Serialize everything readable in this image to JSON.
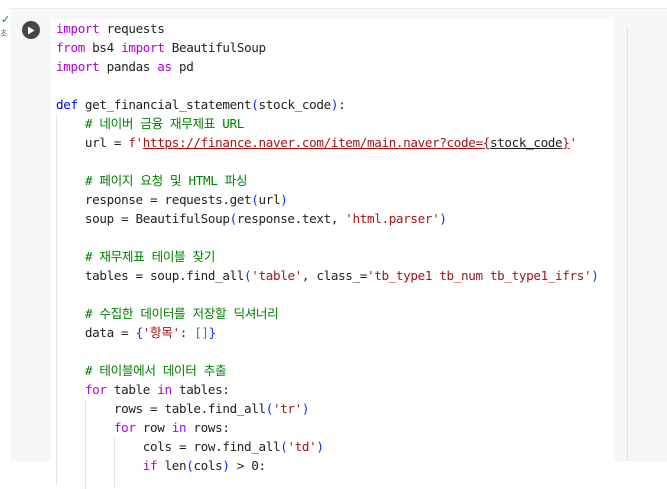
{
  "cell": {
    "status_check": "✓",
    "status_time": "초"
  },
  "code": [
    [
      {
        "t": "import",
        "c": "kw"
      },
      {
        "t": " requests"
      }
    ],
    [
      {
        "t": "from",
        "c": "kw"
      },
      {
        "t": " bs4 "
      },
      {
        "t": "import",
        "c": "kw"
      },
      {
        "t": " BeautifulSoup"
      }
    ],
    [
      {
        "t": "import",
        "c": "kw"
      },
      {
        "t": " pandas "
      },
      {
        "t": "as",
        "c": "kw"
      },
      {
        "t": " pd"
      }
    ],
    [],
    [
      {
        "t": "def",
        "c": "def"
      },
      {
        "t": " get_financial_statement"
      },
      {
        "t": "(",
        "c": "br"
      },
      {
        "t": "stock_code"
      },
      {
        "t": ")",
        "c": "br"
      },
      {
        "t": ":"
      }
    ],
    [
      {
        "t": "    "
      },
      {
        "t": "# 네이버 금융 재무제표 URL",
        "c": "cm"
      }
    ],
    [
      {
        "t": "    url = "
      },
      {
        "t": "f'",
        "c": "str"
      },
      {
        "t": "https://finance.naver.com/item/main.naver?code=",
        "c": "url"
      },
      {
        "t": "{",
        "c": "url"
      },
      {
        "t": "stock_code",
        "c": "url ph"
      },
      {
        "t": "}",
        "c": "url"
      },
      {
        "t": "'",
        "c": "str"
      }
    ],
    [],
    [
      {
        "t": "    "
      },
      {
        "t": "# 페이지 요청 및 HTML 파싱",
        "c": "cm"
      }
    ],
    [
      {
        "t": "    response = requests.get"
      },
      {
        "t": "(",
        "c": "br"
      },
      {
        "t": "url"
      },
      {
        "t": ")",
        "c": "br"
      }
    ],
    [
      {
        "t": "    soup = BeautifulSoup"
      },
      {
        "t": "(",
        "c": "br"
      },
      {
        "t": "response.text, "
      },
      {
        "t": "'html.parser'",
        "c": "str"
      },
      {
        "t": ")",
        "c": "br"
      }
    ],
    [],
    [
      {
        "t": "    "
      },
      {
        "t": "# 재무제표 테이블 찾기",
        "c": "cm"
      }
    ],
    [
      {
        "t": "    tables = soup.find_all"
      },
      {
        "t": "(",
        "c": "br"
      },
      {
        "t": "'table'",
        "c": "str"
      },
      {
        "t": ", class_="
      },
      {
        "t": "'tb_type1 tb_num tb_type1_ifrs'",
        "c": "str"
      },
      {
        "t": ")",
        "c": "br"
      }
    ],
    [],
    [
      {
        "t": "    "
      },
      {
        "t": "# 수집한 데이터를 저장할 딕셔너리",
        "c": "cm"
      }
    ],
    [
      {
        "t": "    data = "
      },
      {
        "t": "{",
        "c": "br"
      },
      {
        "t": "'항목'",
        "c": "str"
      },
      {
        "t": ": "
      },
      {
        "t": "[]",
        "c": "br2"
      },
      {
        "t": "}",
        "c": "br"
      }
    ],
    [],
    [
      {
        "t": "    "
      },
      {
        "t": "# 테이블에서 데이터 추출",
        "c": "cm"
      }
    ],
    [
      {
        "t": "    "
      },
      {
        "t": "for",
        "c": "kw"
      },
      {
        "t": " table "
      },
      {
        "t": "in",
        "c": "kw"
      },
      {
        "t": " tables:"
      }
    ],
    [
      {
        "t": "        rows = table.find_all"
      },
      {
        "t": "(",
        "c": "br"
      },
      {
        "t": "'tr'",
        "c": "str"
      },
      {
        "t": ")",
        "c": "br"
      }
    ],
    [
      {
        "t": "        "
      },
      {
        "t": "for",
        "c": "kw"
      },
      {
        "t": " row "
      },
      {
        "t": "in",
        "c": "kw"
      },
      {
        "t": " rows:"
      }
    ],
    [
      {
        "t": "            cols = row.find_all"
      },
      {
        "t": "(",
        "c": "br"
      },
      {
        "t": "'td'",
        "c": "str"
      },
      {
        "t": ")",
        "c": "br"
      }
    ],
    [
      {
        "t": "            "
      },
      {
        "t": "if",
        "c": "kw"
      },
      {
        "t": " len"
      },
      {
        "t": "(",
        "c": "br"
      },
      {
        "t": "cols"
      },
      {
        "t": ")",
        "c": "br"
      },
      {
        "t": " > 0:"
      }
    ]
  ]
}
